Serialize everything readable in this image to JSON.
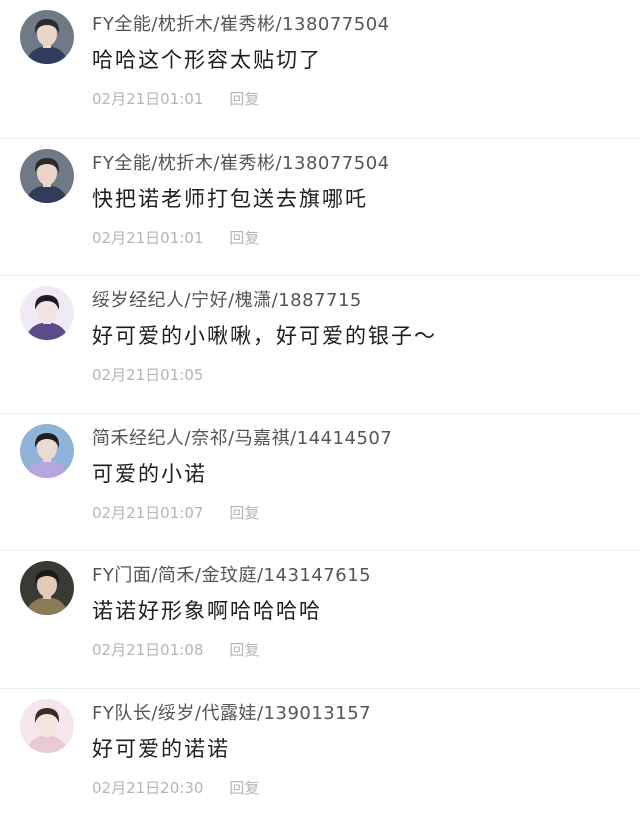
{
  "comments": [
    {
      "author": "FY全能/枕折木/崔秀彬/138077504",
      "text": "哈哈这个形容太贴切了",
      "time": "02月21日01:01",
      "reply": "回复",
      "avatar_icon": "avatar-boy-glasses",
      "avatar_colors": {
        "bg": "#6f7a86",
        "skin": "#e9d6c8",
        "hair": "#2b2b2b",
        "cloth": "#2f3d5a"
      }
    },
    {
      "author": "FY全能/枕折木/崔秀彬/138077504",
      "text": "快把诺老师打包送去旗哪吒",
      "time": "02月21日01:01",
      "reply": "回复",
      "avatar_icon": "avatar-boy-glasses",
      "avatar_colors": {
        "bg": "#6f7a86",
        "skin": "#e9d6c8",
        "hair": "#2b2b2b",
        "cloth": "#2f3d5a"
      }
    },
    {
      "author": "绥岁经纪人/宁好/槐潇/1887715",
      "text": "好可爱的小啾啾，好可爱的银子～",
      "time": "02月21日01:05",
      "reply": "",
      "avatar_icon": "avatar-anime-purple",
      "avatar_colors": {
        "bg": "#efeaf5",
        "skin": "#f1e3e0",
        "hair": "#1f1a2e",
        "cloth": "#5b4b8a"
      }
    },
    {
      "author": "简禾经纪人/奈祁/马嘉祺/14414507",
      "text": "可爱的小诺",
      "time": "02月21日01:07",
      "reply": "回复",
      "avatar_icon": "avatar-boy-lavender",
      "avatar_colors": {
        "bg": "#8fb3d9",
        "skin": "#ecd9cf",
        "hair": "#1e1e1e",
        "cloth": "#b6a6e0"
      }
    },
    {
      "author": "FY门面/简禾/金玟庭/143147615",
      "text": "诺诺好形象啊哈哈哈哈",
      "time": "02月21日01:08",
      "reply": "回复",
      "avatar_icon": "avatar-girl-hat",
      "avatar_colors": {
        "bg": "#3a3a34",
        "skin": "#e3cbb8",
        "hair": "#1a1a1a",
        "cloth": "#8a7a55"
      }
    },
    {
      "author": "FY队长/绥岁/代露娃/139013157",
      "text": "好可爱的诺诺",
      "time": "02月21日20:30",
      "reply": "回复",
      "avatar_icon": "avatar-girl-pink",
      "avatar_colors": {
        "bg": "#f4e6ea",
        "skin": "#f6e4dd",
        "hair": "#3b2a26",
        "cloth": "#e9c9d4"
      }
    }
  ]
}
